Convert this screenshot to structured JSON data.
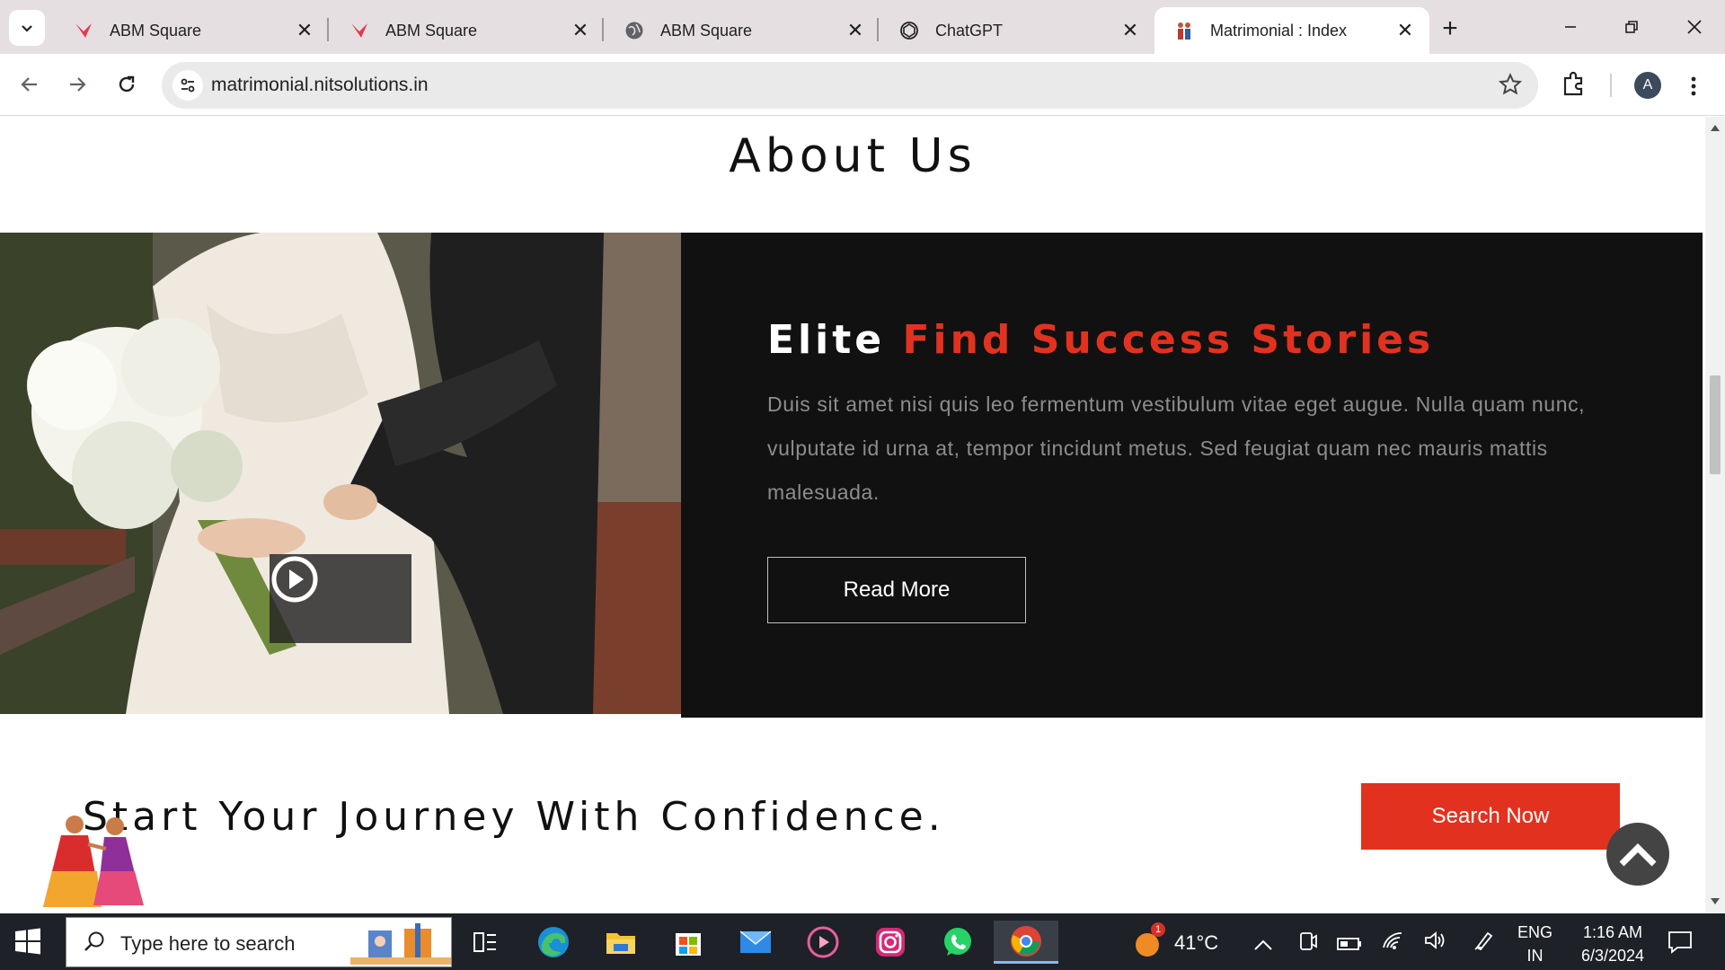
{
  "browser": {
    "tabs": [
      {
        "title": "ABM Square",
        "favicon": "abm-logo-icon"
      },
      {
        "title": "ABM Square",
        "favicon": "abm-logo-icon"
      },
      {
        "title": "ABM Square",
        "favicon": "globe-icon"
      },
      {
        "title": "ChatGPT",
        "favicon": "chatgpt-icon"
      },
      {
        "title": "Matrimonial : Index",
        "favicon": "couple-icon",
        "active": true
      }
    ],
    "close_glyph": "✕",
    "new_tab_glyph": "+",
    "url": "matrimonial.nitsolutions.in",
    "profile_initial": "A"
  },
  "page": {
    "about_title": "About Us",
    "heading_white": "Elite",
    "heading_red": "Find Success Stories",
    "paragraph": "Duis sit amet nisi quis leo fermentum vestibulum vitae eget augue. Nulla quam nunc, vulputate id urna at, tempor tincidunt metus. Sed feugiat quam nec mauris mattis malesuada.",
    "read_more_label": "Read More",
    "journey_text": "Start Your Journey With Confidence.",
    "search_now_label": "Search Now"
  },
  "taskbar": {
    "search_placeholder": "Type here to search",
    "temperature": "41°C",
    "weather_badge": "1",
    "language_line1": "ENG",
    "language_line2": "IN",
    "time": "1:16 AM",
    "date": "6/3/2024"
  },
  "colors": {
    "accent_red": "#e2321f",
    "panel_dark": "#111111",
    "tabstrip_bg": "#e6dfe2"
  }
}
